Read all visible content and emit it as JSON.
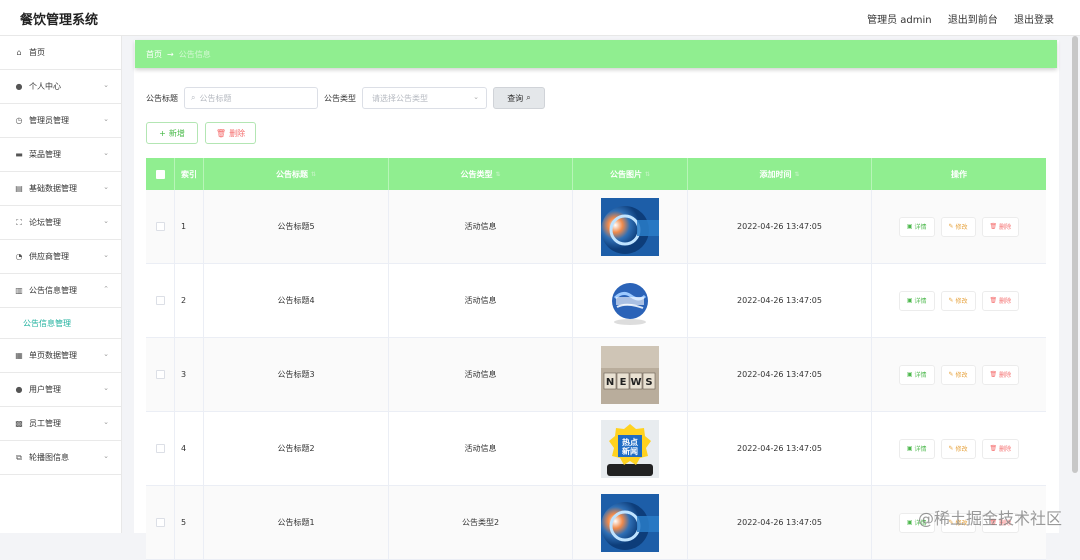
{
  "header": {
    "title": "餐饮管理系统",
    "user": "管理员 admin",
    "front": "退出到前台",
    "logout": "退出登录"
  },
  "sidebar": {
    "items": [
      {
        "label": "首页",
        "icon": "home-icon",
        "glyph": "⌂",
        "chev": ""
      },
      {
        "label": "个人中心",
        "icon": "user-icon",
        "glyph": "●",
        "chev": "⌄"
      },
      {
        "label": "管理员管理",
        "icon": "clock-icon",
        "glyph": "◷",
        "chev": "⌄"
      },
      {
        "label": "菜品管理",
        "icon": "dish-icon",
        "glyph": "▬",
        "chev": "⌄"
      },
      {
        "label": "基础数据管理",
        "icon": "box-icon",
        "glyph": "▤",
        "chev": "⌄"
      },
      {
        "label": "论坛管理",
        "icon": "frame-icon",
        "glyph": "⛶",
        "chev": "⌄"
      },
      {
        "label": "供应商管理",
        "icon": "gauge-icon",
        "glyph": "◔",
        "chev": "⌄"
      },
      {
        "label": "公告信息管理",
        "icon": "chart-icon",
        "glyph": "▥",
        "chev": "⌃"
      },
      {
        "label": "单页数据管理",
        "icon": "doc-icon",
        "glyph": "▦",
        "chev": "⌄"
      },
      {
        "label": "用户管理",
        "icon": "user-icon",
        "glyph": "●",
        "chev": "⌄"
      },
      {
        "label": "员工管理",
        "icon": "staff-icon",
        "glyph": "▩",
        "chev": "⌄"
      },
      {
        "label": "轮播图信息",
        "icon": "copy-icon",
        "glyph": "⧉",
        "chev": "⌄"
      }
    ],
    "sub": "公告信息管理"
  },
  "breadcrumb": {
    "home": "首页",
    "arrow": "→",
    "current": "公告信息"
  },
  "search": {
    "title_label": "公告标题",
    "title_placeholder": "公告标题",
    "type_label": "公告类型",
    "type_placeholder": "请选择公告类型",
    "button": "查询"
  },
  "actions": {
    "add": "新增",
    "delete": "删除"
  },
  "table": {
    "headers": {
      "index": "索引",
      "title": "公告标题",
      "type": "公告类型",
      "image": "公告图片",
      "time": "添加时间",
      "ops": "操作"
    },
    "rows": [
      {
        "index": "1",
        "title": "公告标题5",
        "type": "活动信息",
        "time": "2022-04-26 13:47:05",
        "img": "news-globe"
      },
      {
        "index": "2",
        "title": "公告标题4",
        "type": "活动信息",
        "time": "2022-04-26 13:47:05",
        "img": "globe"
      },
      {
        "index": "3",
        "title": "公告标题3",
        "type": "活动信息",
        "time": "2022-04-26 13:47:05",
        "img": "news-blocks"
      },
      {
        "index": "4",
        "title": "公告标题2",
        "type": "活动信息",
        "time": "2022-04-26 13:47:05",
        "img": "hot-news"
      },
      {
        "index": "5",
        "title": "公告标题1",
        "type": "公告类型2",
        "time": "2022-04-26 13:47:05",
        "img": "news-globe"
      }
    ],
    "ops": {
      "detail": "详情",
      "edit": "修改",
      "del": "删除"
    }
  },
  "hot_news_text": [
    "热点",
    "新闻"
  ],
  "news_text": "NEWS",
  "watermark": "@稀土掘金技术社区",
  "colors": {
    "accent": "#90ee90",
    "active": "#1fb19e",
    "danger": "#f56c6c",
    "warning": "#e6a23c"
  }
}
